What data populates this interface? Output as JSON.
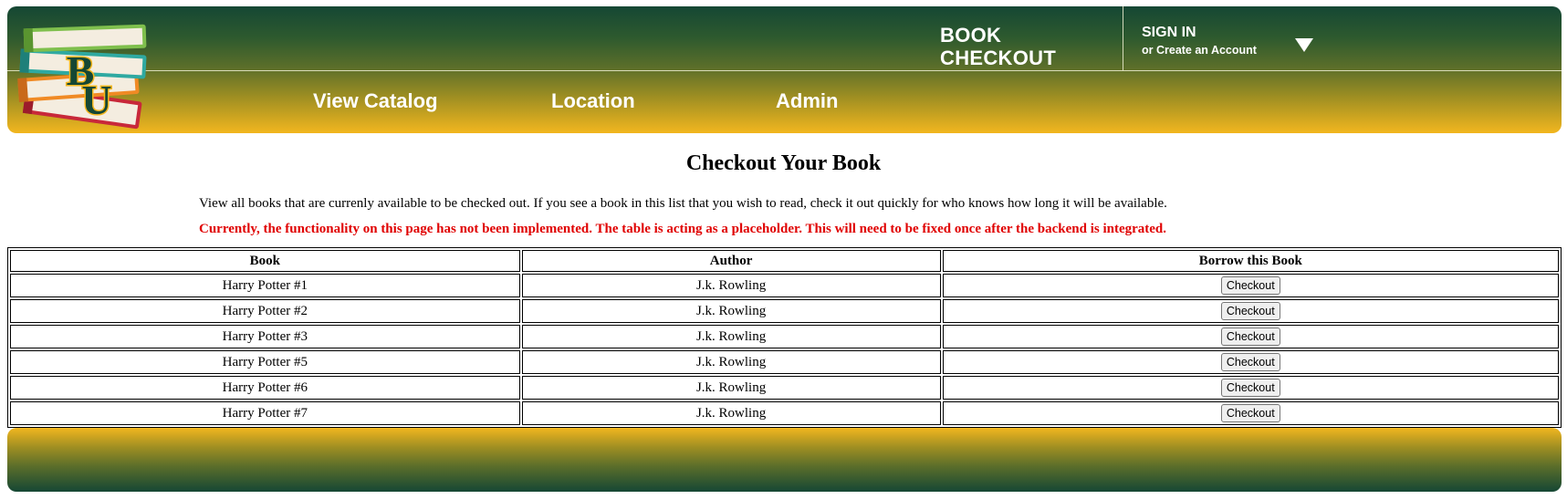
{
  "header": {
    "title": "BOOK CHECKOUT",
    "title_line1": "BOOK",
    "title_line2": "CHECKOUT",
    "signin_label": "SIGN IN",
    "create_account_label": "or Create an Account"
  },
  "nav": {
    "items": [
      {
        "label": "View Catalog"
      },
      {
        "label": "Location"
      },
      {
        "label": "Admin"
      }
    ]
  },
  "main": {
    "title": "Checkout Your Book",
    "intro": "View all books that are currenly available to be checked out. If you see a book in this list that you wish to read, check it out quickly for who knows how long it will be available.",
    "warning": "Currently, the functionality on this page has not been implemented. The table is acting as a placeholder. This will need to be fixed once after the backend is integrated."
  },
  "table": {
    "headers": [
      "Book",
      "Author",
      "Borrow this Book"
    ],
    "button_label": "Checkout",
    "rows": [
      {
        "book": "Harry Potter #1",
        "author": "J.k. Rowling"
      },
      {
        "book": "Harry Potter #2",
        "author": "J.k. Rowling"
      },
      {
        "book": "Harry Potter #3",
        "author": "J.k. Rowling"
      },
      {
        "book": "Harry Potter #5",
        "author": "J.k. Rowling"
      },
      {
        "book": "Harry Potter #6",
        "author": "J.k. Rowling"
      },
      {
        "book": "Harry Potter #7",
        "author": "J.k. Rowling"
      }
    ]
  },
  "logo": {
    "icon": "books-stack-bu-logo-icon",
    "letters": "BU"
  },
  "colors": {
    "brand_green": "#154734",
    "brand_gold": "#f2b61f",
    "warning_red": "#e00000"
  }
}
